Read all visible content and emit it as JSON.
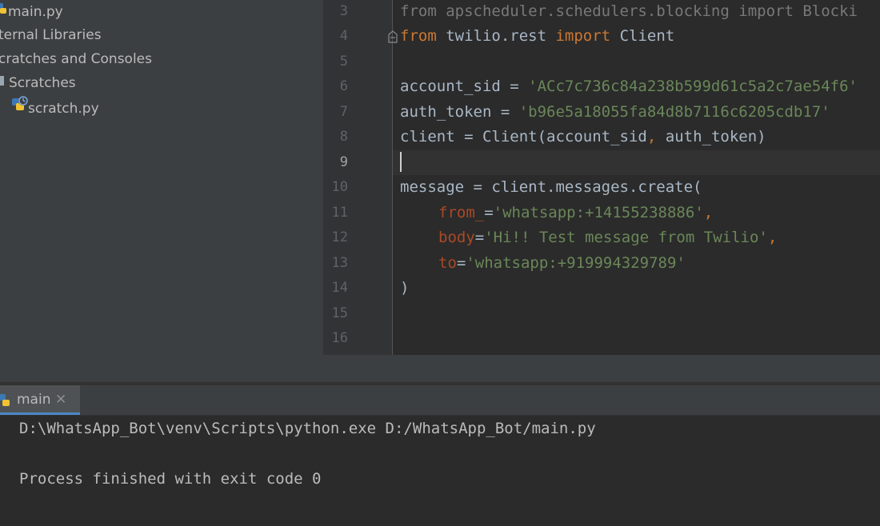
{
  "project_tree": {
    "items": [
      {
        "label": "main.py",
        "icon": "python-file-icon"
      },
      {
        "label": "ternal Libraries",
        "icon": "external-libraries-icon"
      },
      {
        "label": "cratches and Consoles",
        "icon": "scratches-icon"
      },
      {
        "label": "Scratches",
        "icon": "folder-icon"
      },
      {
        "label": "scratch.py",
        "icon": "python-scratch-file-icon"
      }
    ]
  },
  "editor": {
    "line_numbers": [
      "3",
      "4",
      "5",
      "6",
      "7",
      "8",
      "9",
      "10",
      "11",
      "12",
      "13",
      "14",
      "15",
      "16"
    ],
    "current_line": "9",
    "lines": {
      "l3": {
        "kw1": "from",
        "mod": " apscheduler.schedulers.blocking ",
        "kw2": "import",
        "name": " Blocki"
      },
      "l4": {
        "kw1": "from",
        "mod": " twilio.rest ",
        "kw2": "import",
        "name": " Client"
      },
      "l6": {
        "var": "account_sid = ",
        "str": "'ACc7c736c84a238b599d61c5a2c7ae54f6'"
      },
      "l7": {
        "var": "auth_token = ",
        "str": "'b96e5a18055fa84d8b7116c6205cdb17'"
      },
      "l8": {
        "a": "client = Client(account_sid",
        "comma": ",",
        "b": " auth_token)"
      },
      "l10": {
        "text": "message = client.messages.create("
      },
      "l11": {
        "param": "from_",
        "eq": "=",
        "str": "'whatsapp:+14155238886'",
        "comma": ","
      },
      "l12": {
        "param": "body",
        "eq": "=",
        "str": "'Hi!! Test message from Twilio'",
        "comma": ","
      },
      "l13": {
        "param": "to",
        "eq": "=",
        "str": "'whatsapp:+919994329789'"
      },
      "l14": {
        "text": ")"
      }
    }
  },
  "run_window": {
    "tab_label": "main",
    "tab_icon": "python-run-icon",
    "close_glyph": "✕",
    "console": [
      "D:\\WhatsApp_Bot\\venv\\Scripts\\python.exe D:/WhatsApp_Bot/main.py",
      "",
      "Process finished with exit code 0"
    ]
  },
  "colors": {
    "keyword": "#cc7832",
    "string": "#6a8759",
    "param": "#aa4926",
    "text": "#a9b7c6",
    "accent": "#4a88c7"
  }
}
